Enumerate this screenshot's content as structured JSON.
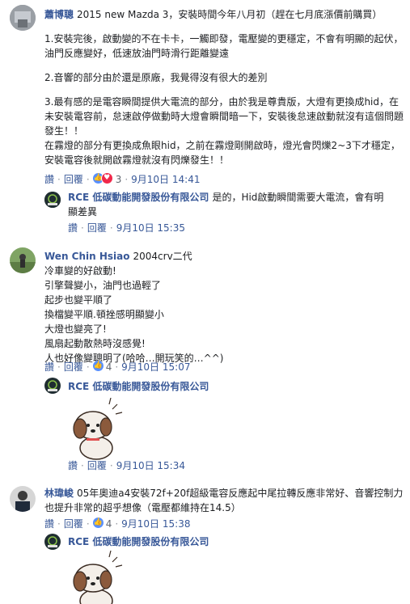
{
  "comments": [
    {
      "author": "蕭博聰",
      "lines": [
        "2015 new Mazda 3，安裝時間今年八月初（趕在七月底漲價前購買）"
      ],
      "paragraphs": [
        "1.安裝完後，啟動變的不在卡卡，一觸即發，電壓變的更穩定，不會有明顯的起伏，油門反應變好，低速放油門時滑行距離變遠",
        "2.音響的部分由於還是原廠，我覺得沒有很大的差別",
        "3.最有感的是電容瞬間提供大電流的部分，由於我是尊貴版，大燈有更換成hid，在未安裝電容前，怠速啟停做動時大燈會瞬間暗一下，安裝後怠速啟動就沒有這個問題發生！！\n在霧燈的部分有更換成魚眼hid，之前在霧燈剛開啟時，燈光會閃爍2~3下才穩定，安裝電容後就開啟霧燈就沒有閃爍發生！！"
      ],
      "actions": {
        "like": "讚",
        "reply": "回覆",
        "count": "3",
        "time": "9月10日 14:41"
      },
      "reply": {
        "author": "RCE 低碳動能開發股份有限公司",
        "text": "是的，Hid啟動瞬間需要大電流，會有明顯差異",
        "actions": {
          "like": "讚",
          "reply": "回覆",
          "time": "9月10日 15:35"
        }
      }
    },
    {
      "author": "Wen Chin Hsiao",
      "first": "2004crv二代",
      "lines": [
        "冷車變的好啟動!",
        "引擎聲變小，油門也過輕了",
        "起步也變平順了",
        "換檔變平順.頓挫感明顯變小",
        "大燈也變亮了!",
        "風扇起動散熱時沒感覺!",
        "人也好像變聰明了(哈哈…開玩笑的…^^)"
      ],
      "actions": {
        "like": "讚",
        "reply": "回覆",
        "count": "4",
        "time": "9月10日 15:07"
      },
      "reply": {
        "author": "RCE 低碳動能開發股份有限公司",
        "actions": {
          "like": "讚",
          "reply": "回覆",
          "time": "9月10日 15:34"
        }
      }
    },
    {
      "author": "林瑋峻",
      "text": "05年奧迪a4安裝72f+20f超級電容反應起中尾拉轉反應非常好、音響控制力也提升非常的超乎想像（電壓都維持在14.5）",
      "actions": {
        "like": "讚",
        "reply": "回覆",
        "count": "4",
        "time": "9月10日 15:38"
      },
      "reply": {
        "author": "RCE 低碳動能開發股份有限公司"
      }
    }
  ],
  "colors": {
    "link": "#385898",
    "meta": "#616770",
    "like": "#5890ff",
    "love": "#f0284a"
  }
}
